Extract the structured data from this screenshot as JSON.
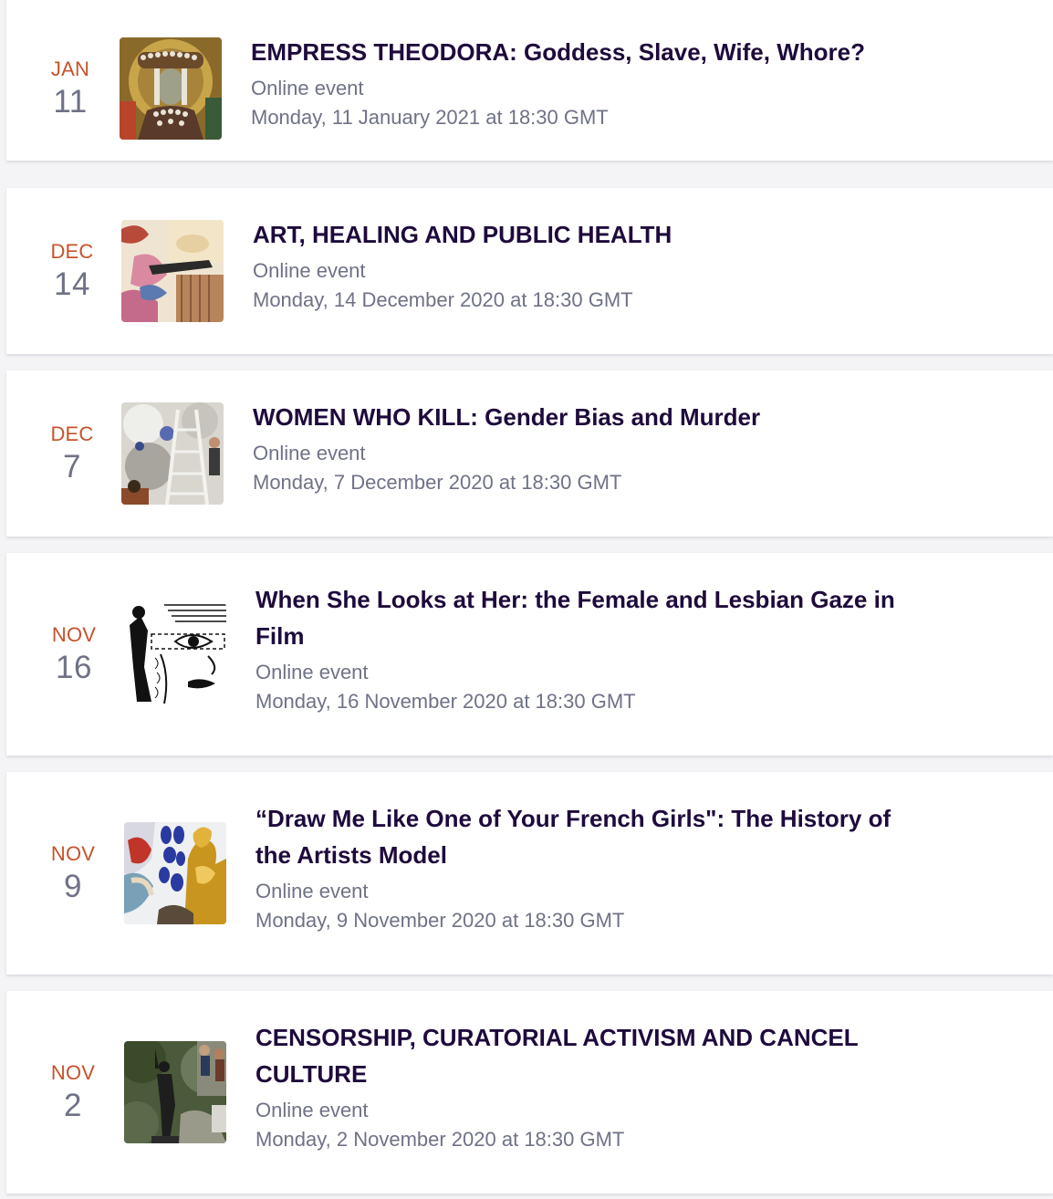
{
  "events": [
    {
      "month": "JAN",
      "day": "11",
      "title": "EMPRESS THEODORA: Goddess, Slave, Wife, Whore?",
      "location": "Online event",
      "datetime": "Monday, 11 January 2021 at 18:30 GMT",
      "image_icon": "mosaic-portrait-icon"
    },
    {
      "month": "DEC",
      "day": "14",
      "title": "ART, HEALING AND PUBLIC HEALTH",
      "location": "Online event",
      "datetime": "Monday, 14 December 2020 at 18:30 GMT",
      "image_icon": "collage-art-icon"
    },
    {
      "month": "DEC",
      "day": "7",
      "title": "WOMEN WHO KILL: Gender Bias and Murder",
      "location": "Online event",
      "datetime": "Monday, 7 December 2020 at 18:30 GMT",
      "image_icon": "ladder-scene-icon"
    },
    {
      "month": "NOV",
      "day": "16",
      "title": "When She Looks at Her: the Female and Lesbian Gaze in Film",
      "location": "Online event",
      "datetime": "Monday, 16 November 2020 at 18:30 GMT",
      "image_icon": "comic-eye-icon"
    },
    {
      "month": "NOV",
      "day": "9",
      "title": "“Draw Me Like One of Your French Girls\": The History of the Artists Model",
      "location": "Online event",
      "datetime": "Monday, 9 November 2020 at 18:30 GMT",
      "image_icon": "gold-figure-icon"
    },
    {
      "month": "NOV",
      "day": "2",
      "title": "CENSORSHIP, CURATORIAL ACTIVISM AND CANCEL CULTURE",
      "location": "Online event",
      "datetime": "Monday, 2 November 2020 at 18:30 GMT",
      "image_icon": "statue-photo-icon"
    }
  ],
  "colors": {
    "month": "#c7522a",
    "day": "#6f7287",
    "title": "#1e0a3c",
    "meta": "#6f7287"
  }
}
